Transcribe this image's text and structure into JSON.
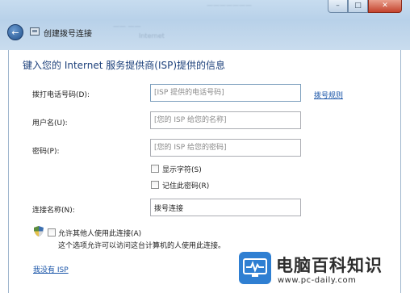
{
  "window": {
    "title": "创建拨号连接",
    "background_text": [
      "Internet"
    ],
    "controls": {
      "minimize": "–",
      "maximize": "□",
      "close": "✕"
    }
  },
  "heading": "键入您的 Internet 服务提供商(ISP)提供的信息",
  "fields": {
    "phone": {
      "label": "拨打电话号码(D):",
      "placeholder": "[ISP 提供的电话号码]",
      "value": ""
    },
    "username": {
      "label": "用户名(U):",
      "placeholder": "[您的 ISP 给您的名称]",
      "value": ""
    },
    "password": {
      "label": "密码(P):",
      "placeholder": "[您的 ISP 给您的密码]",
      "value": ""
    },
    "connection_name": {
      "label": "连接名称(N):",
      "value": "拨号连接"
    }
  },
  "links": {
    "dialing_rules": "拨号规则",
    "no_isp": "我没有 ISP"
  },
  "checkboxes": {
    "show_chars": {
      "label": "显示字符(S)",
      "checked": false
    },
    "remember_password": {
      "label": "记住此密码(R)",
      "checked": false
    },
    "allow_others": {
      "label": "允许其他人使用此连接(A)",
      "checked": false
    }
  },
  "allow_note": "这个选项允许可以访问这台计算机的人使用此连接。",
  "watermark": {
    "title": "电脑百科知识",
    "url": "www.pc-daily.com"
  },
  "colors": {
    "heading": "#1b3f7a",
    "link": "#1a55a8",
    "chrome": "#b8d1e9",
    "watermark_icon": "#2f7fd2"
  }
}
